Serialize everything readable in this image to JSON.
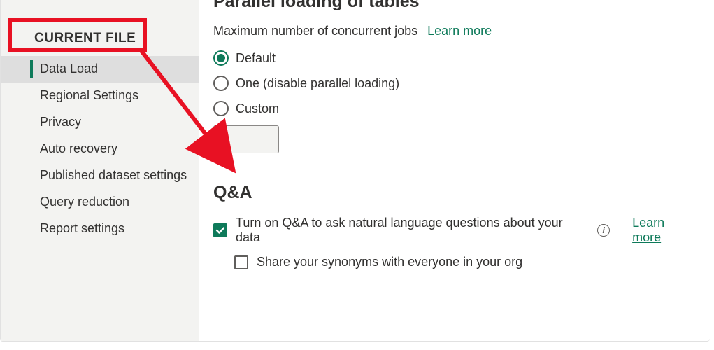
{
  "sidebar": {
    "section": "CURRENT FILE",
    "items": [
      {
        "label": "Data Load"
      },
      {
        "label": "Regional Settings"
      },
      {
        "label": "Privacy"
      },
      {
        "label": "Auto recovery"
      },
      {
        "label": "Published dataset settings"
      },
      {
        "label": "Query reduction"
      },
      {
        "label": "Report settings"
      }
    ]
  },
  "main": {
    "parallel": {
      "heading": "Parallel loading of tables",
      "field_label": "Maximum number of concurrent jobs",
      "learn_more": "Learn more",
      "options": {
        "default": "Default",
        "one": "One (disable parallel loading)",
        "custom": "Custom"
      }
    },
    "qa": {
      "heading": "Q&A",
      "turn_on": "Turn on Q&A to ask natural language questions about your data",
      "learn_more": "Learn more",
      "share_synonyms": "Share your synonyms with everyone in your org"
    }
  }
}
